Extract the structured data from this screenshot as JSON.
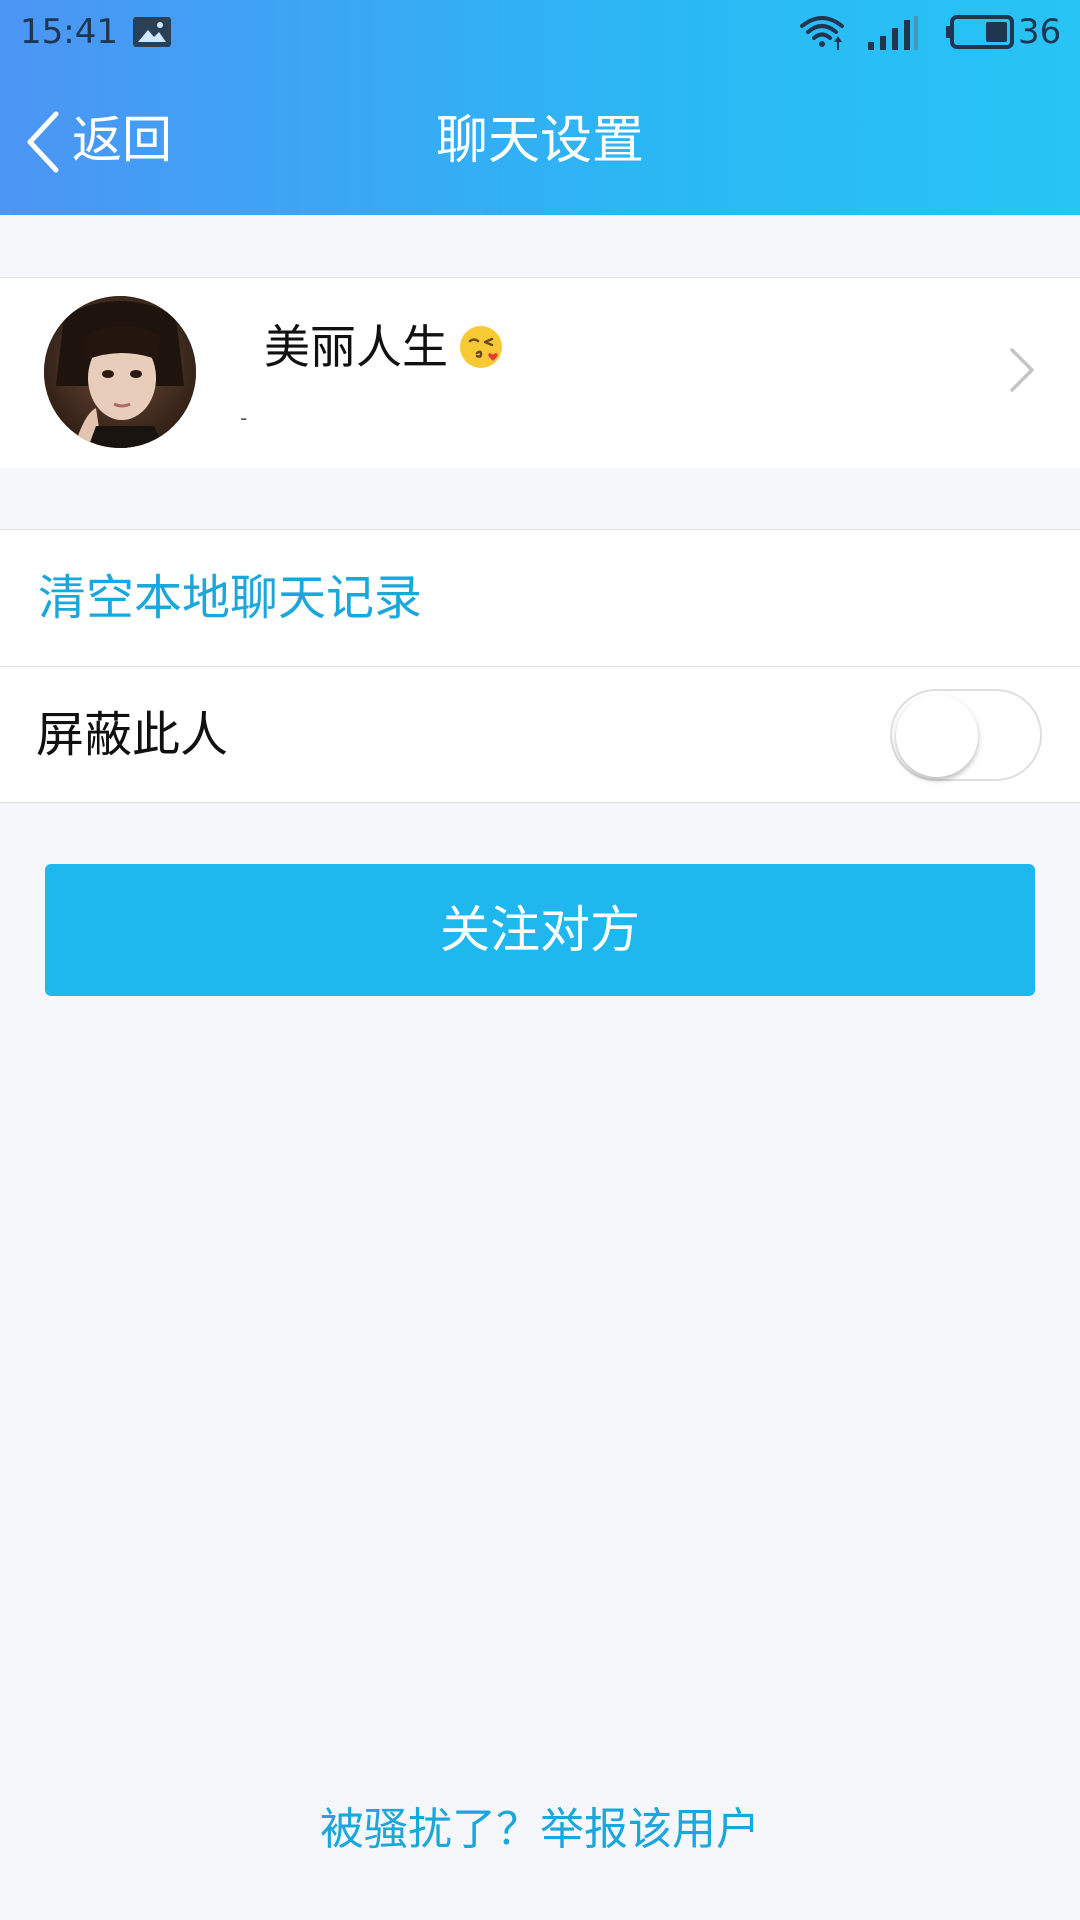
{
  "status_bar": {
    "time": "15:41",
    "battery_level": "36",
    "icons": [
      "image-notification-icon",
      "wifi-icon",
      "signal-icon",
      "battery-icon"
    ]
  },
  "nav": {
    "back_label": "返回",
    "title": "聊天设置"
  },
  "profile": {
    "name": "美丽人生",
    "emoji_icon": "kissing-face-emoji-icon",
    "subtitle": "-"
  },
  "settings": {
    "clear_records_label": "清空本地聊天记录",
    "block_label": "屏蔽此人",
    "block_enabled": false
  },
  "follow_button": {
    "label": "关注对方"
  },
  "report": {
    "label": "被骚扰了？举报该用户"
  },
  "colors": {
    "header_gradient_start": "#4c95f4",
    "header_gradient_end": "#27c4f5",
    "accent_blue": "#1ba6dc",
    "button_blue": "#1fb8ee",
    "background": "#f5f7fa"
  }
}
